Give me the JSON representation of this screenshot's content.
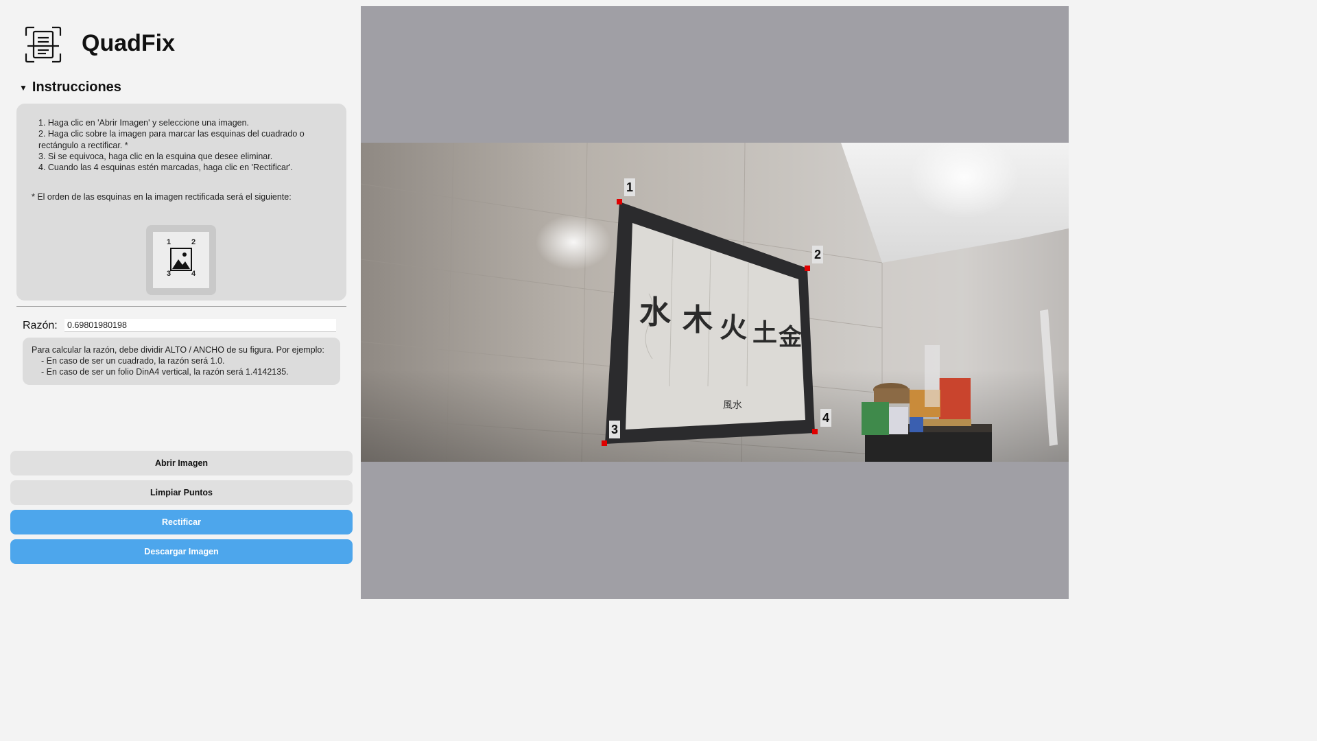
{
  "app": {
    "title": "QuadFix",
    "logo_icon": "document-scan-icon"
  },
  "instructions": {
    "toggle_label": "Instrucciones",
    "toggle_icon": "triangle-down-icon",
    "steps": [
      "1. Haga clic en 'Abrir Imagen' y seleccione una imagen.",
      "2. Haga clic sobre la imagen para marcar las esquinas del cuadrado o rectángulo a rectificar. *",
      "3. Si se equivoca, haga clic en la esquina que desee eliminar.",
      "4. Cuando las 4 esquinas estén marcadas, haga clic en 'Rectificar'."
    ],
    "note": "* El orden de las esquinas en la imagen rectificada será el siguiente:",
    "order_diagram": {
      "icon": "image-icon",
      "corners": [
        "1",
        "2",
        "3",
        "4"
      ]
    }
  },
  "ratio": {
    "label": "Razón:",
    "value": "0.69801980198",
    "help": {
      "intro": "Para calcular la razón, debe dividir ALTO / ANCHO de su figura. Por ejemplo:",
      "example_square": "-   En caso de ser un cuadrado, la razón será 1.0.",
      "example_a4": "-   En caso de ser un folio DinA4 vertical, la razón será 1.4142135."
    }
  },
  "buttons": {
    "open": "Abrir Imagen",
    "clear": "Limpiar Puntos",
    "rectify": "Rectificar",
    "download": "Descargar Imagen"
  },
  "image_view": {
    "corner_labels": [
      "1",
      "2",
      "3",
      "4"
    ],
    "artwork_characters": [
      "水",
      "木",
      "火",
      "土",
      "金"
    ],
    "artwork_caption": "風水"
  },
  "colors": {
    "accent_button": "#4da6ec",
    "secondary_button": "#e0e0e0",
    "canvas_background": "#a09fa5",
    "corner_marker": "#e00000"
  }
}
